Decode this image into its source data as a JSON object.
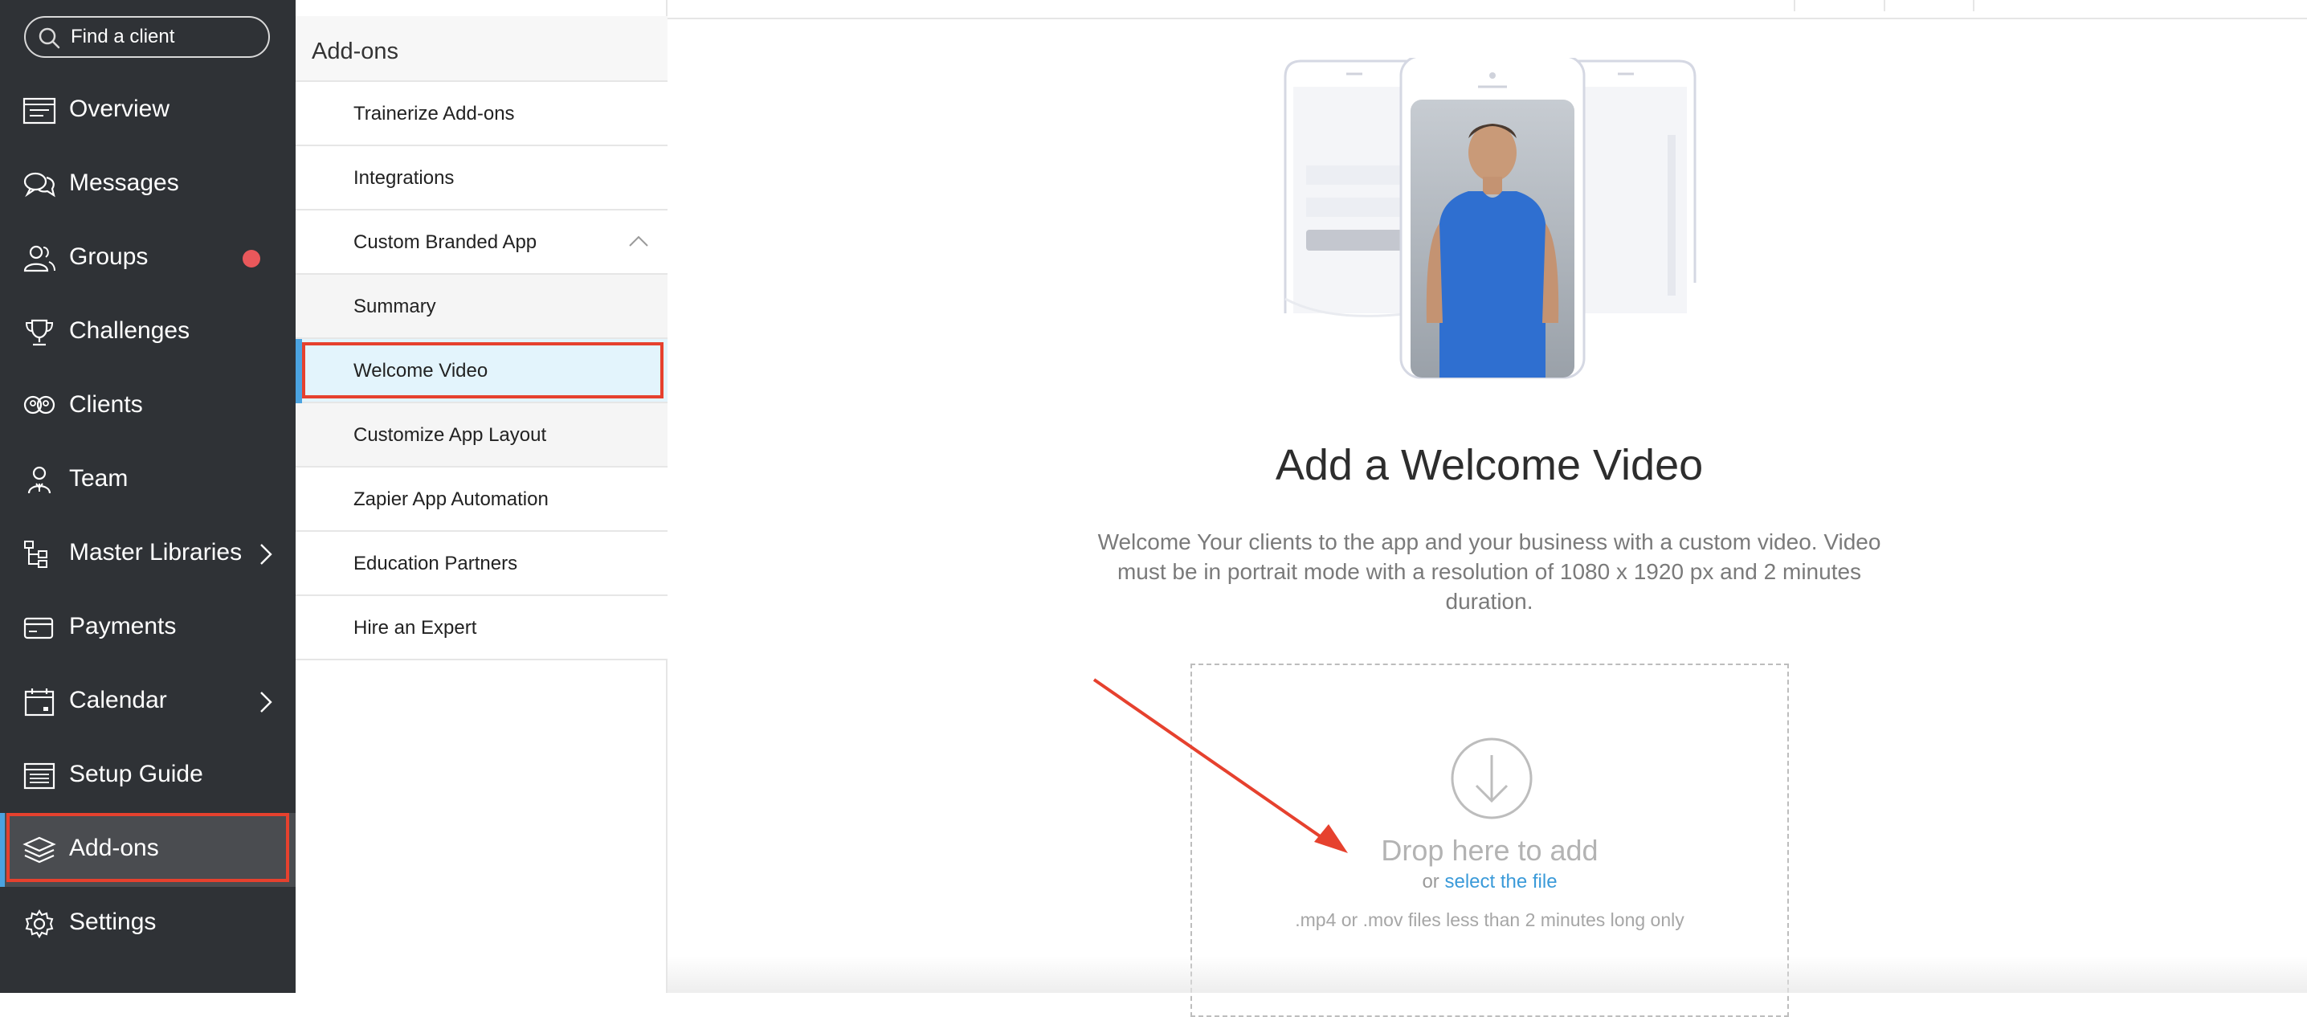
{
  "search": {
    "placeholder": "Find a client"
  },
  "nav": {
    "items": [
      {
        "label": "Overview",
        "icon": "overview-icon"
      },
      {
        "label": "Messages",
        "icon": "messages-icon"
      },
      {
        "label": "Groups",
        "icon": "groups-icon",
        "badge_color": "#e9585b"
      },
      {
        "label": "Challenges",
        "icon": "trophy-icon"
      },
      {
        "label": "Clients",
        "icon": "clients-icon"
      },
      {
        "label": "Team",
        "icon": "team-icon"
      },
      {
        "label": "Master Libraries",
        "icon": "libraries-icon",
        "has_submenu": true
      },
      {
        "label": "Payments",
        "icon": "payments-icon"
      },
      {
        "label": "Calendar",
        "icon": "calendar-icon",
        "has_submenu": true
      },
      {
        "label": "Setup Guide",
        "icon": "setup-guide-icon"
      },
      {
        "label": "Add-ons",
        "icon": "addons-icon",
        "active": true
      },
      {
        "label": "Settings",
        "icon": "gear-icon"
      }
    ]
  },
  "subnav": {
    "title": "Add-ons",
    "items": [
      {
        "label": "Trainerize Add-ons"
      },
      {
        "label": "Integrations"
      },
      {
        "label": "Custom Branded App",
        "expanded": true
      },
      {
        "label": "Summary",
        "child": true
      },
      {
        "label": "Welcome Video",
        "child": true,
        "selected": true
      },
      {
        "label": "Customize App Layout",
        "child": true
      },
      {
        "label": "Zapier App Automation"
      },
      {
        "label": "Education Partners"
      },
      {
        "label": "Hire an Expert"
      }
    ]
  },
  "main": {
    "title": "Add a Welcome Video",
    "description": "Welcome Your clients to the app and your business with a custom video. Video must be in portrait mode with a resolution of 1080 x 1920 px and 2 minutes duration.",
    "dropzone": {
      "title": "Drop here to add",
      "or_text": "or",
      "link_text": "select the file",
      "note": ".mp4 or .mov files less than 2 minutes long only"
    }
  },
  "colors": {
    "nav_bg": "#2f3236",
    "active_bg": "#4a4c50",
    "accent": "#4ba3e0",
    "highlight": "#e6412e",
    "link": "#3a9ad9"
  }
}
